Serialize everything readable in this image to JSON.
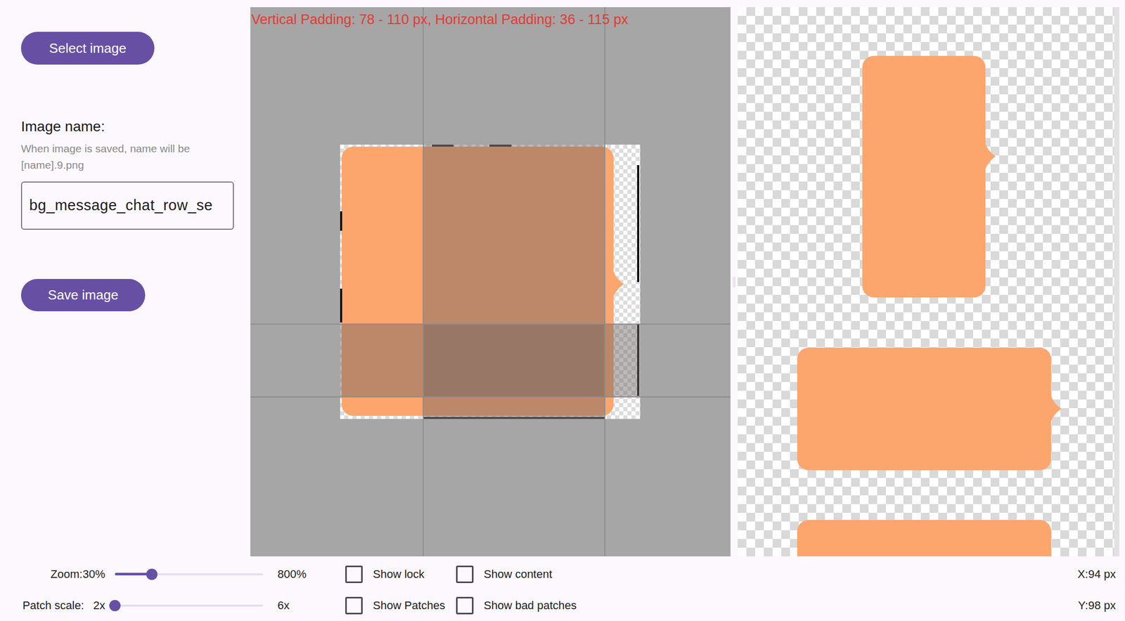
{
  "left_panel": {
    "select_button": "Select image",
    "image_name_label": "Image name:",
    "image_name_hint": "When image is saved, name will be [name].9.png",
    "image_name_value": "bg_message_chat_row_se",
    "save_button": "Save image"
  },
  "editor": {
    "padding_info": "Vertical Padding: 78 - 110 px, Horizontal Padding: 36 - 115 px"
  },
  "controls": {
    "zoom": {
      "label": "Zoom:30%",
      "level": 0.25,
      "max": "800%"
    },
    "patch_scale": {
      "label": "Patch scale:",
      "value": "2x",
      "level": 0,
      "max": "6x"
    },
    "checkboxes": [
      {
        "label": "Show lock",
        "checked": false
      },
      {
        "label": "Show content",
        "checked": false
      },
      {
        "label": "Show Patches",
        "checked": false
      },
      {
        "label": "Show bad patches",
        "checked": false
      }
    ],
    "x": "X:94 px",
    "y": "Y:98 px"
  }
}
